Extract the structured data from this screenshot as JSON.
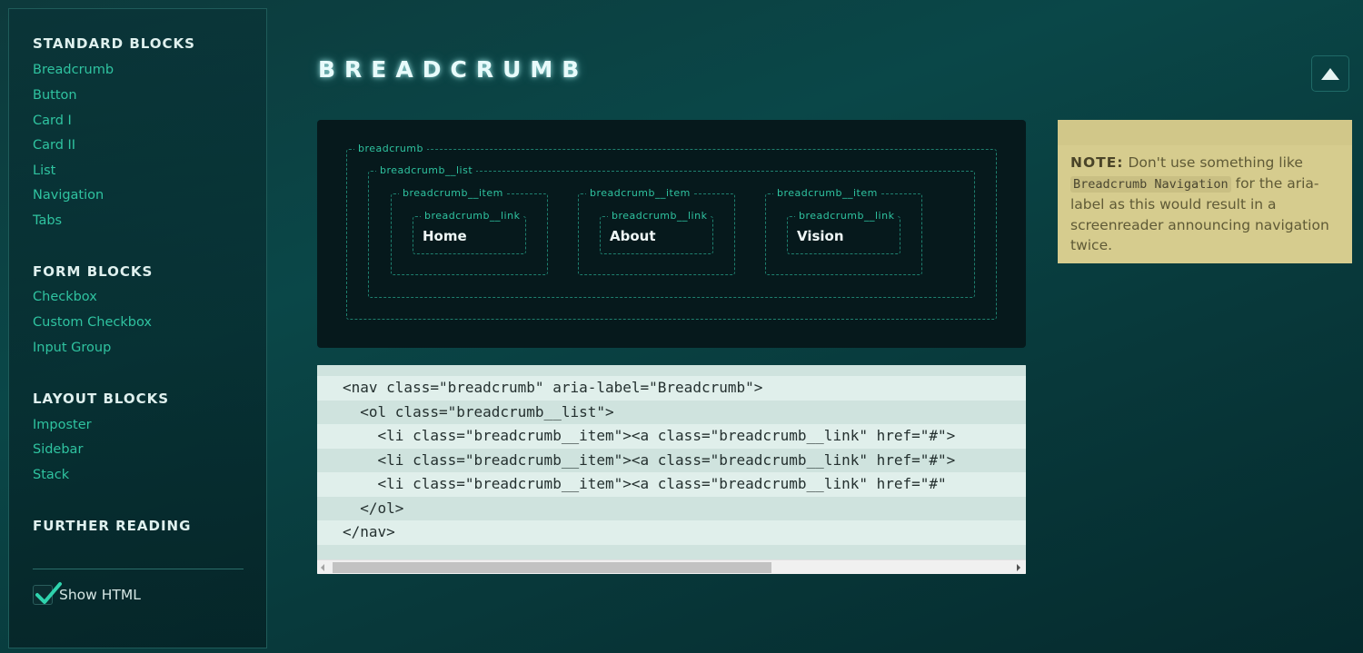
{
  "sidebar": {
    "sections": [
      {
        "title": "STANDARD BLOCKS",
        "items": [
          "Breadcrumb",
          "Button",
          "Card I",
          "Card II",
          "List",
          "Navigation",
          "Tabs"
        ]
      },
      {
        "title": "FORM BLOCKS",
        "items": [
          "Checkbox",
          "Custom Checkbox",
          "Input Group"
        ]
      },
      {
        "title": "LAYOUT BLOCKS",
        "items": [
          "Imposter",
          "Sidebar",
          "Stack"
        ]
      },
      {
        "title": "FURTHER READING",
        "items": []
      }
    ],
    "show_html": {
      "label": "Show HTML",
      "checked": true
    }
  },
  "page": {
    "title": "BREADCRUMB",
    "scroll_top_icon": "triangle-up-icon"
  },
  "demo": {
    "labels": {
      "root": "breadcrumb",
      "list": "breadcrumb__list",
      "item": "breadcrumb__item",
      "link": "breadcrumb__link"
    },
    "crumbs": [
      "Home",
      "About",
      "Vision"
    ]
  },
  "code": {
    "lines": [
      "<nav class=\"breadcrumb\" aria-label=\"Breadcrumb\">",
      "  <ol class=\"breadcrumb__list\">",
      "    <li class=\"breadcrumb__item\"><a class=\"breadcrumb__link\" href=\"#\">",
      "    <li class=\"breadcrumb__item\"><a class=\"breadcrumb__link\" href=\"#\">",
      "    <li class=\"breadcrumb__item\"><a class=\"breadcrumb__link\" href=\"#\" ",
      "  </ol>",
      "</nav>"
    ]
  },
  "note": {
    "label": "NOTE:",
    "text_before": " Don't use something like ",
    "code": "Breadcrumb Navigation",
    "text_after": " for the aria-label as this would result in a screenreader announcing navigation twice."
  },
  "colors": {
    "accent": "#2fc3a0",
    "note_bg": "#d6cc8e",
    "code_bg": "#d8ebe6",
    "demo_bg": "#06191c"
  }
}
